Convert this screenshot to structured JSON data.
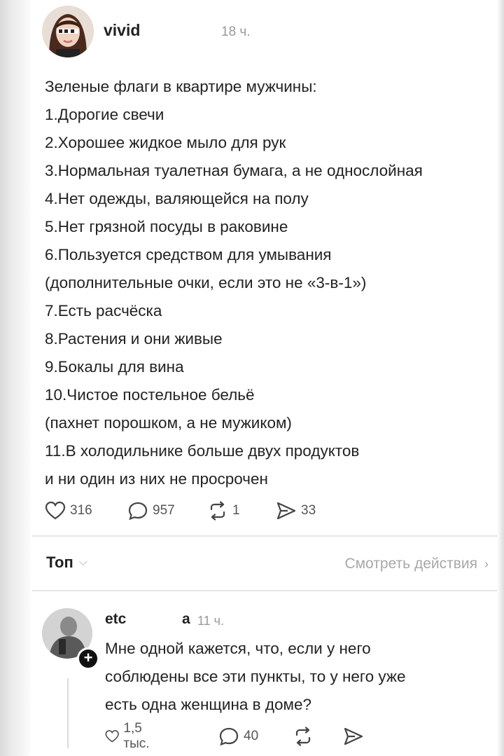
{
  "post": {
    "author": "vivid",
    "time": "18 ч.",
    "lines": [
      "Зеленые флаги в квартире мужчины:",
      "1.Дорогие свечи",
      "2.Хорошее жидкое мыло для рук",
      "3.Нормальная туалетная бумага, а не однослойная",
      "4.Нет одежды, валяющейся на полу",
      "5.Нет грязной посуды в раковине",
      "6.Пользуется средством для умывания",
      "(дополнительные очки, если это не «3-в-1»)",
      "7.Есть расчёска",
      "8.Растения и они живые",
      "9.Бокалы для вина",
      "10.Чистое постельное бельё",
      "(пахнет порошком, а не мужиком)",
      "11.В холодильнике больше двух продуктов",
      "и ни один из них не просрочен"
    ],
    "likes": "316",
    "comments": "957",
    "reposts": "1",
    "shares": "33"
  },
  "sort_bar": {
    "label": "Топ",
    "view_activity": "Смотреть действия"
  },
  "comment": {
    "author": "etc",
    "author_tail": "a",
    "time": "11 ч.",
    "lines": [
      "Мне одной кажется, что, если у него",
      "соблюдены все эти пункты, то у него уже",
      "есть одна женщина в доме?"
    ],
    "likes": "1,5 тыс.",
    "comments": "40"
  },
  "icons": {
    "like": "heart-icon",
    "comment": "speech-bubble-icon",
    "repost": "repost-icon",
    "share": "send-icon",
    "follow": "plus-icon"
  },
  "colors": {
    "text": "#222222",
    "muted": "#9a9a9a",
    "divider": "#e6e6e6"
  }
}
